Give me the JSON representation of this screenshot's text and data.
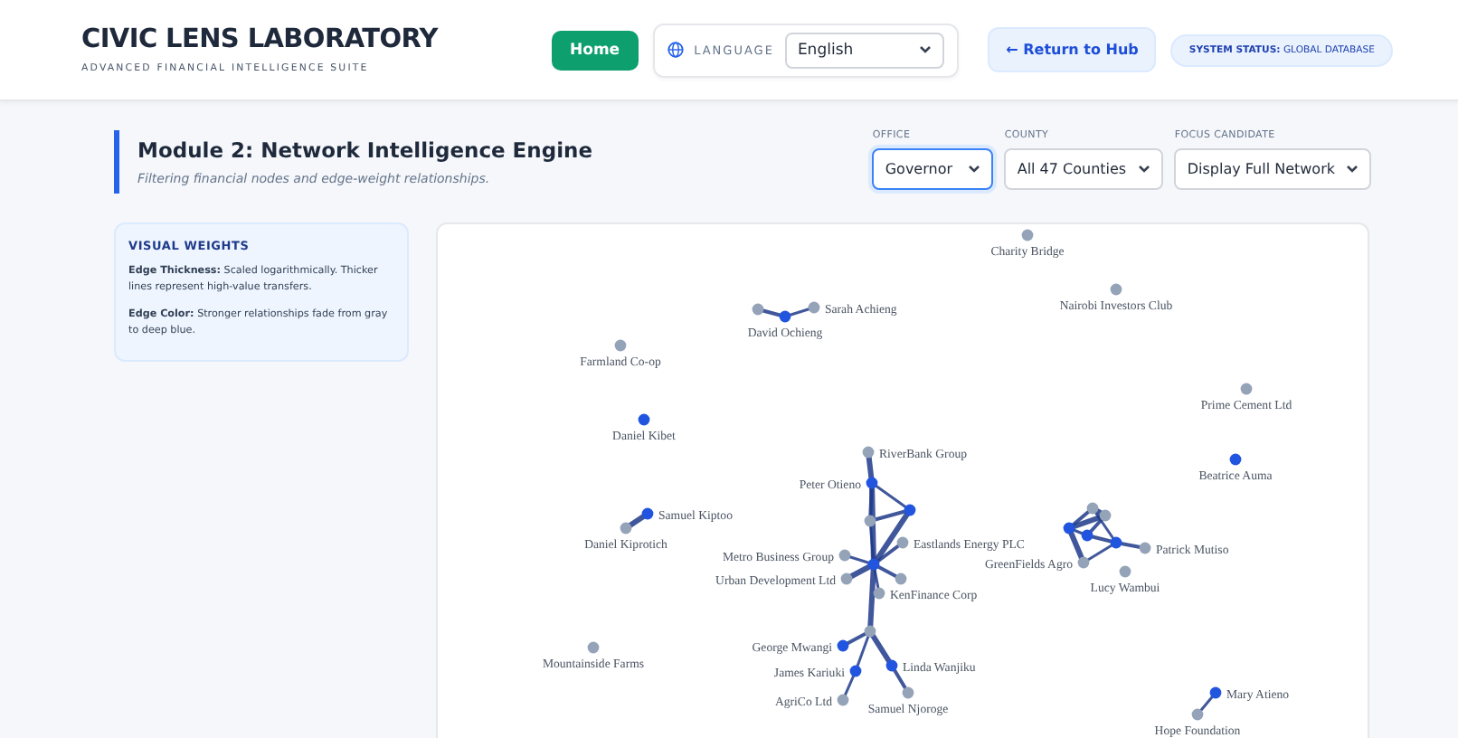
{
  "header": {
    "title": "CIVIC LENS LABORATORY",
    "subtitle": "ADVANCED FINANCIAL INTELLIGENCE SUITE",
    "home_button": "Home",
    "language_label": "LANGUAGE",
    "language_value": "English",
    "return_button": "← Return to Hub",
    "status_label": "SYSTEM STATUS:",
    "status_value": "GLOBAL DATABASE"
  },
  "module": {
    "title": "Module 2: Network Intelligence Engine",
    "subtitle": "Filtering financial nodes and edge-weight relationships."
  },
  "filters": [
    {
      "label": "OFFICE",
      "value": "Governor",
      "selected": true
    },
    {
      "label": "COUNTY",
      "value": "All 47 Counties",
      "selected": false
    },
    {
      "label": "FOCUS CANDIDATE",
      "value": "Display Full Network",
      "selected": false
    }
  ],
  "legend": {
    "title": "VISUAL WEIGHTS",
    "items": [
      {
        "term": "Edge Thickness:",
        "text": "Scaled logarithmically. Thicker lines represent high-value transfers."
      },
      {
        "term": "Edge Color:",
        "text": "Stronger relationships fade from gray to deep blue."
      }
    ]
  },
  "network": {
    "nodes": [
      {
        "label": "Charity Bridge",
        "kind": "entity"
      },
      {
        "kind": "entity"
      },
      {
        "label": "Sarah Achieng",
        "kind": "entity"
      },
      {
        "label": "Nairobi Investors Club",
        "kind": "entity"
      },
      {
        "label": "David Ochieng",
        "kind": "candidate"
      },
      {
        "label": "Farmland Co-op",
        "kind": "entity"
      },
      {
        "label": "Prime Cement Ltd",
        "kind": "entity"
      },
      {
        "label": "Daniel Kibet",
        "kind": "candidate"
      },
      {
        "label": "RiverBank Group",
        "kind": "entity"
      },
      {
        "label": "Beatrice Auma",
        "kind": "candidate"
      },
      {
        "label": "Peter Otieno",
        "kind": "candidate"
      },
      {
        "label": "Samuel Kiptoo",
        "kind": "candidate"
      },
      {
        "kind": "candidate"
      },
      {
        "kind": "entity"
      },
      {
        "kind": "entity"
      },
      {
        "kind": "entity"
      },
      {
        "label": "Daniel Kiprotich",
        "kind": "entity"
      },
      {
        "kind": "candidate"
      },
      {
        "kind": "candidate"
      },
      {
        "label": "Eastlands Energy PLC",
        "kind": "entity"
      },
      {
        "kind": "candidate"
      },
      {
        "label": "Patrick Mutiso",
        "kind": "entity"
      },
      {
        "label": "Metro Business Group",
        "kind": "entity"
      },
      {
        "label": "GreenFields Agro",
        "kind": "entity"
      },
      {
        "kind": "candidate"
      },
      {
        "label": "Lucy Wambui",
        "kind": "entity"
      },
      {
        "label": "Urban Development Ltd",
        "kind": "entity"
      },
      {
        "kind": "entity"
      },
      {
        "label": "KenFinance Corp",
        "kind": "entity"
      },
      {
        "kind": "entity"
      },
      {
        "label": "George Mwangi",
        "kind": "candidate"
      },
      {
        "label": "Mountainside Farms",
        "kind": "entity"
      },
      {
        "label": "James Kariuki",
        "kind": "candidate"
      },
      {
        "label": "Linda Wanjiku",
        "kind": "candidate"
      },
      {
        "label": "AgriCo Ltd",
        "kind": "entity"
      },
      {
        "label": "Samuel Njoroge",
        "kind": "entity"
      },
      {
        "label": "Mary Atieno",
        "kind": "candidate"
      },
      {
        "label": "Hope Foundation",
        "kind": "entity"
      }
    ]
  }
}
